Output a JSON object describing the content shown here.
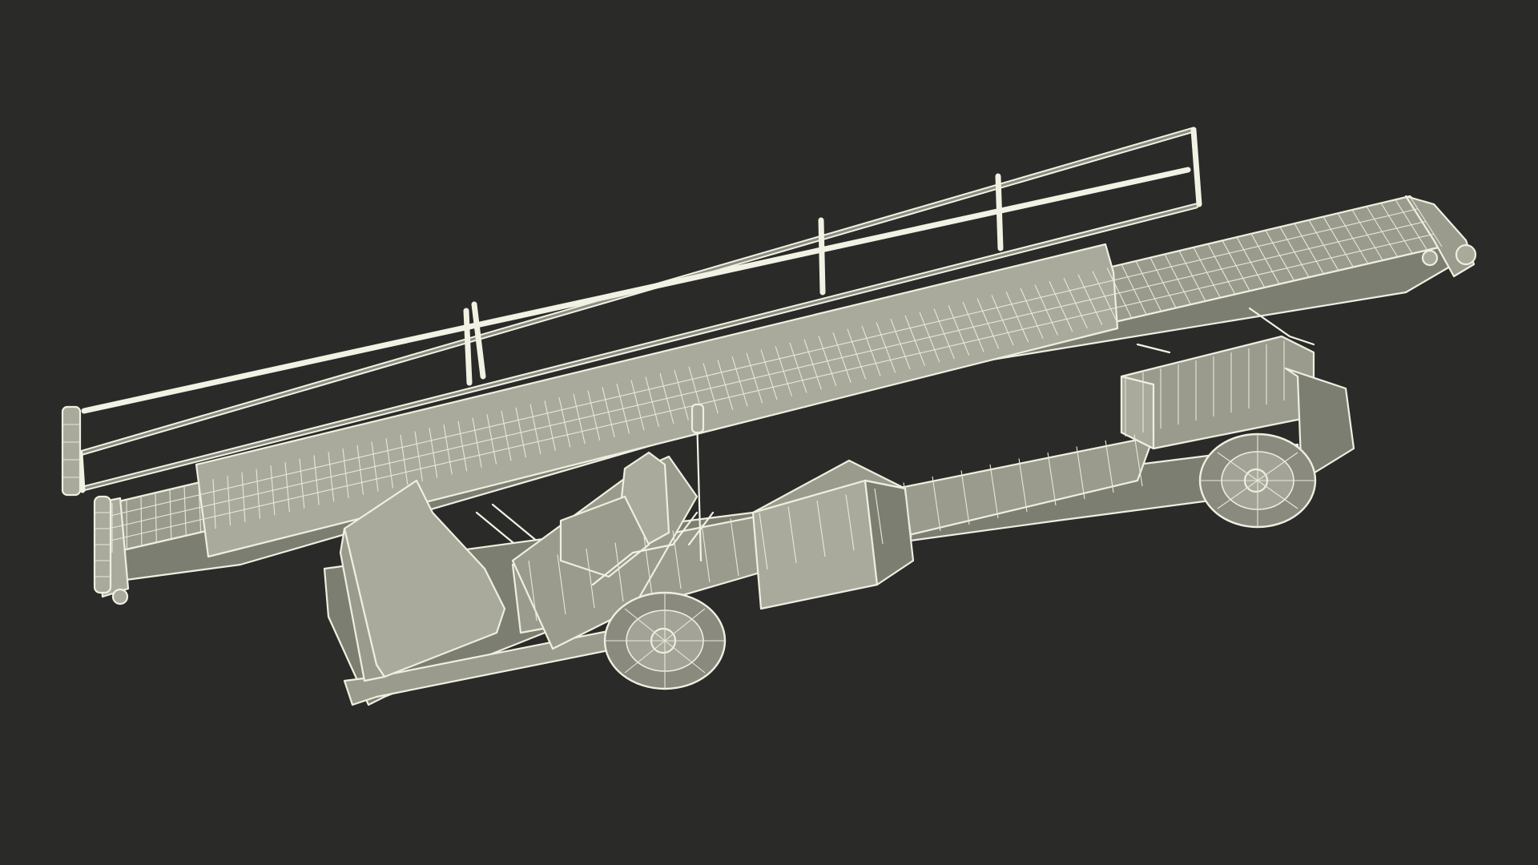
{
  "scene": {
    "background_color": "#2a2a29",
    "wire_color": "#efefe0",
    "surface_color": "#9a9b8d"
  }
}
